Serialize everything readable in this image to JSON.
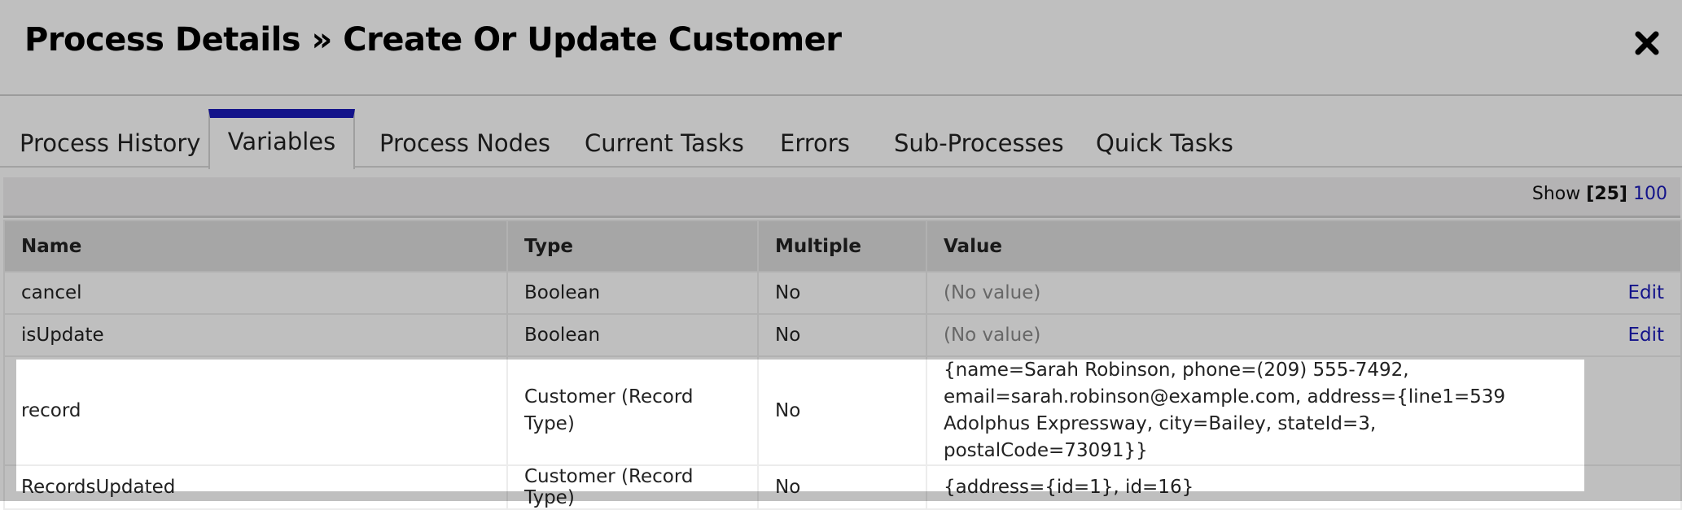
{
  "dialog": {
    "title": "Process Details » Create Or Update Customer",
    "close_icon": "close-icon"
  },
  "tabs": [
    {
      "label": "Process History",
      "active": false
    },
    {
      "label": "Variables",
      "active": true
    },
    {
      "label": "Process Nodes",
      "active": false
    },
    {
      "label": "Current Tasks",
      "active": false
    },
    {
      "label": "Errors",
      "active": false
    },
    {
      "label": "Sub-Processes",
      "active": false
    },
    {
      "label": "Quick Tasks",
      "active": false
    }
  ],
  "toolbar": {
    "show_label": "Show",
    "show_current": "[25]",
    "show_option": "100"
  },
  "table": {
    "columns": [
      "Name",
      "Type",
      "Multiple",
      "Value"
    ],
    "rows": [
      {
        "name": "cancel",
        "type": "Boolean",
        "multiple": "No",
        "value": "(No value)",
        "action": "Edit"
      },
      {
        "name": "isUpdate",
        "type": "Boolean",
        "multiple": "No",
        "value": "(No value)",
        "action": "Edit"
      },
      {
        "name": "record",
        "type": "Customer (Record Type)",
        "multiple": "No",
        "value": "{name=Sarah Robinson, phone=(209) 555-7492, email=sarah.robinson@example.com, address={line1=539 Adolphus Expressway, city=Bailey, stateId=3, postalCode=73091}}"
      },
      {
        "name": "RecordsUpdated",
        "type": "Customer (Record Type)",
        "multiple": "No",
        "value": "{address={id=1}, id=16}"
      }
    ]
  },
  "colors": {
    "accent": "#1a1ab8",
    "link": "#1a1ab8",
    "muted_text": "#8a8a8a"
  }
}
